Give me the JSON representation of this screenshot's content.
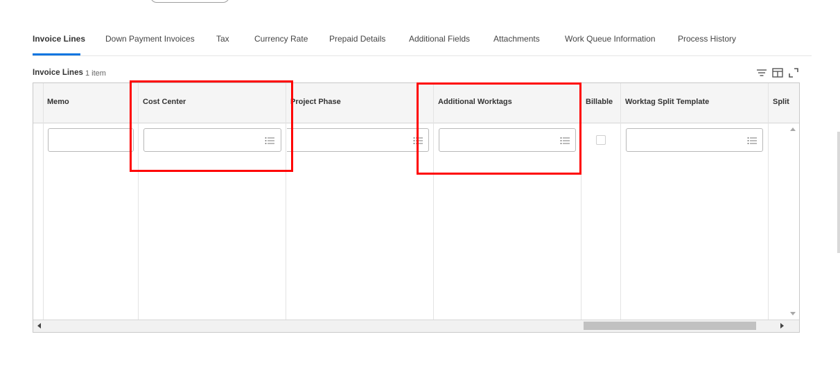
{
  "tabs": [
    {
      "label": "Invoice Lines",
      "active": true
    },
    {
      "label": "Down Payment Invoices",
      "active": false
    },
    {
      "label": "Tax",
      "active": false
    },
    {
      "label": "Currency Rate",
      "active": false
    },
    {
      "label": "Prepaid Details",
      "active": false
    },
    {
      "label": "Additional Fields",
      "active": false
    },
    {
      "label": "Attachments",
      "active": false
    },
    {
      "label": "Work Queue Information",
      "active": false
    },
    {
      "label": "Process History",
      "active": false
    }
  ],
  "section": {
    "title": "Invoice Lines",
    "count": "1 item"
  },
  "toolbar": {
    "icons": [
      "filter-icon",
      "column-settings-icon",
      "expand-icon"
    ]
  },
  "grid": {
    "columns": [
      "Memo",
      "Cost Center",
      "Project Phase",
      "Additional Worktags",
      "Billable",
      "Worktag Split Template",
      "Split"
    ],
    "row": {
      "memo": "",
      "cost_center": "",
      "project_phase": "",
      "additional_worktags": "",
      "billable": false,
      "worktag_split_template": ""
    }
  },
  "colors": {
    "accent": "#0875e1",
    "highlight": "#ff0000",
    "header_bg": "#f5f5f5"
  }
}
